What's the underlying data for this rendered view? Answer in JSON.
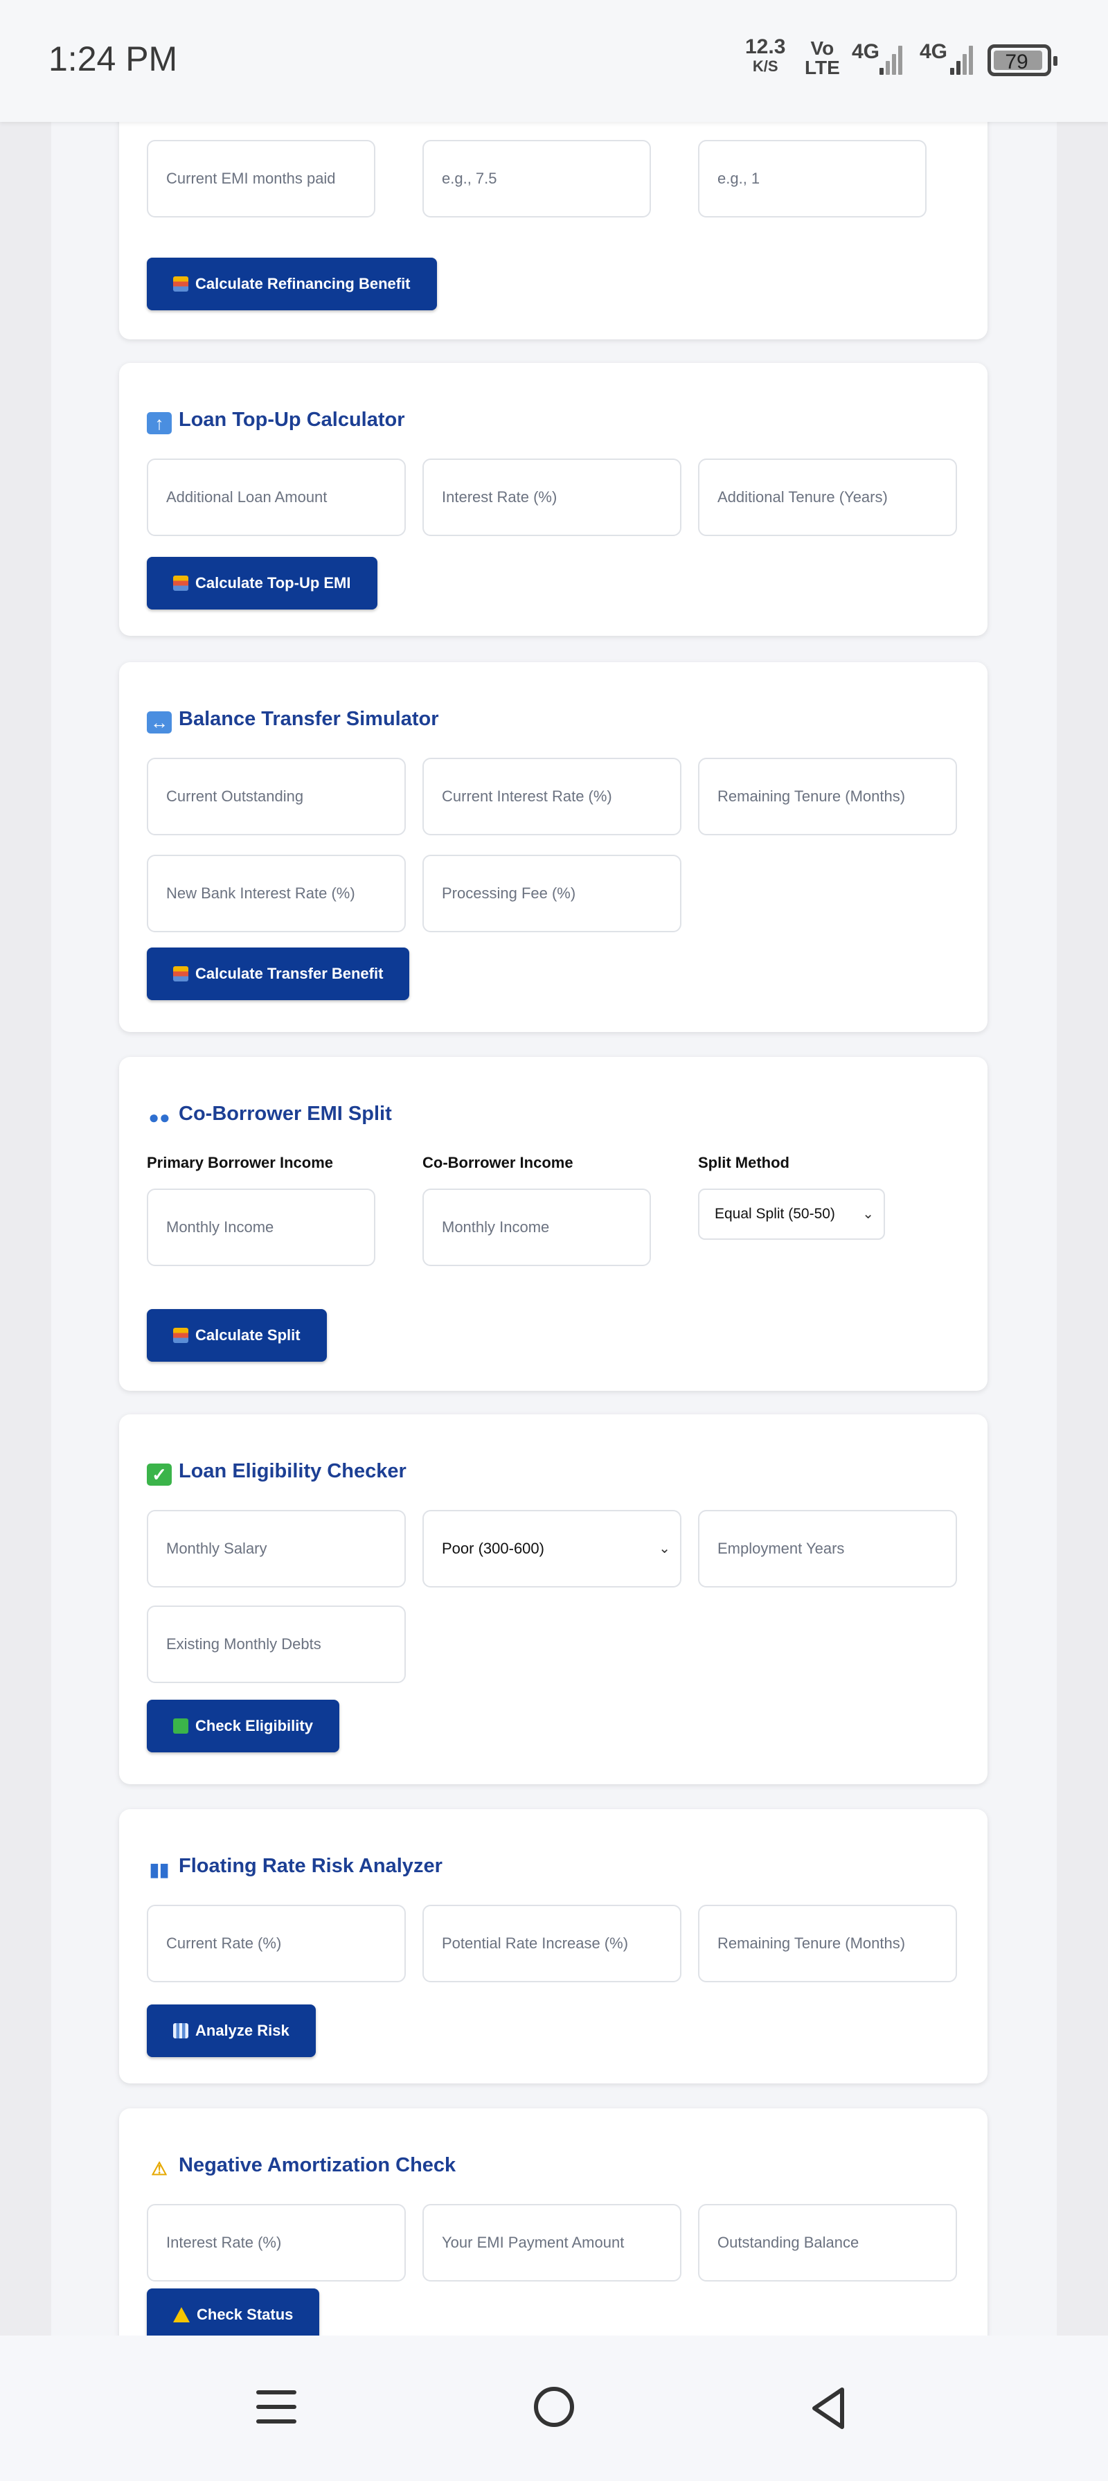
{
  "status_bar": {
    "time": "1:24 PM",
    "speed_value": "12.3",
    "speed_unit": "K/S",
    "volte_top": "Vo",
    "volte_bottom": "LTE",
    "net1": "4G",
    "net2": "4G",
    "battery": "79"
  },
  "refinance_card": {
    "fields": [
      "Current EMI months paid",
      "e.g., 7.5",
      "e.g., 1"
    ],
    "button": "Calculate Refinancing Benefit"
  },
  "topup_card": {
    "title": "Loan Top-Up Calculator",
    "fields": [
      "Additional Loan Amount",
      "Interest Rate (%)",
      "Additional Tenure (Years)"
    ],
    "button": "Calculate Top-Up EMI"
  },
  "transfer_card": {
    "title": "Balance Transfer Simulator",
    "fields": [
      "Current Outstanding",
      "Current Interest Rate (%)",
      "Remaining Tenure (Months)",
      "New Bank Interest Rate (%)",
      "Processing Fee (%)"
    ],
    "button": "Calculate Transfer Benefit"
  },
  "coborrower_card": {
    "title": "Co-Borrower EMI Split",
    "labels": [
      "Primary Borrower Income",
      "Co-Borrower Income",
      "Split Method"
    ],
    "fields": [
      "Monthly Income",
      "Monthly Income"
    ],
    "split_method_value": "Equal Split (50-50)",
    "button": "Calculate Split"
  },
  "eligibility_card": {
    "title": "Loan Eligibility Checker",
    "fields": [
      "Monthly Salary",
      "Employment Years",
      "Existing Monthly Debts"
    ],
    "credit_score_value": "Poor (300-600)",
    "button": "Check Eligibility"
  },
  "floating_card": {
    "title": "Floating Rate Risk Analyzer",
    "fields": [
      "Current Rate (%)",
      "Potential Rate Increase (%)",
      "Remaining Tenure (Months)"
    ],
    "button": "Analyze Risk"
  },
  "amortization_card": {
    "title": "Negative Amortization Check",
    "fields": [
      "Interest Rate (%)",
      "Your EMI Payment Amount",
      "Outstanding Balance"
    ],
    "button": "Check Status"
  },
  "colors": {
    "accent": "#0d3a94",
    "title": "#1c3f94"
  }
}
